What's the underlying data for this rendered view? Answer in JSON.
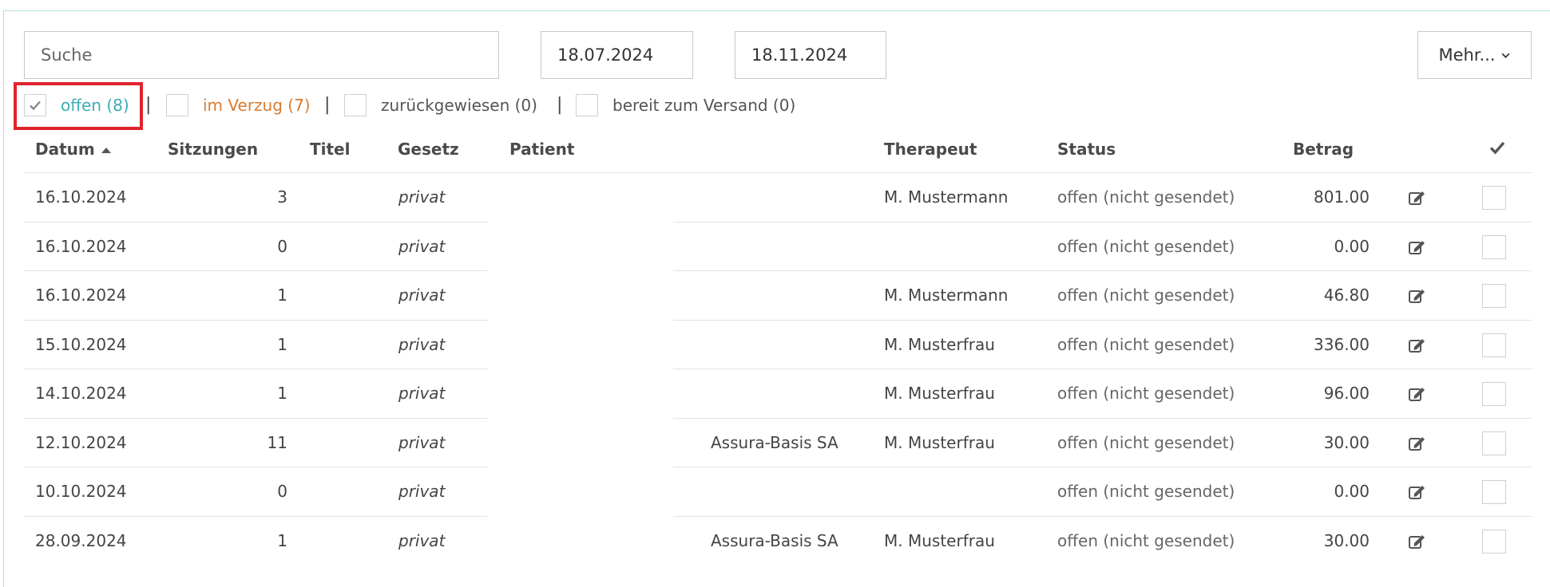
{
  "search": {
    "placeholder": "Suche"
  },
  "date_range": {
    "from": "18.07.2024",
    "to": "18.11.2024"
  },
  "more_button": {
    "label": "Mehr..."
  },
  "filters": [
    {
      "label": "offen (8)",
      "checked": true,
      "color": "#3aaeb5"
    },
    {
      "label": "im Verzug (7)",
      "checked": false,
      "color": "#d97b2e"
    },
    {
      "label": "zurückgewiesen (0)",
      "checked": false,
      "color": "#555555"
    },
    {
      "label": "bereit zum Versand (0)",
      "checked": false,
      "color": "#555555"
    }
  ],
  "separator": "|",
  "table": {
    "columns": {
      "date": "Datum",
      "sessions": "Sitzungen",
      "title": "Titel",
      "law": "Gesetz",
      "patient": "Patient",
      "therapist": "Therapeut",
      "status": "Status",
      "amount": "Betrag"
    },
    "sort": {
      "column": "date",
      "direction": "ascending"
    },
    "rows": [
      {
        "date": "16.10.2024",
        "sessions": "3",
        "law": "privat",
        "insurer": "",
        "therapist": "M. Mustermann",
        "status": "offen (nicht gesendet)",
        "amount": "801.00"
      },
      {
        "date": "16.10.2024",
        "sessions": "0",
        "law": "privat",
        "insurer": "",
        "therapist": "",
        "status": "offen (nicht gesendet)",
        "amount": "0.00"
      },
      {
        "date": "16.10.2024",
        "sessions": "1",
        "law": "privat",
        "insurer": "",
        "therapist": "M. Mustermann",
        "status": "offen (nicht gesendet)",
        "amount": "46.80"
      },
      {
        "date": "15.10.2024",
        "sessions": "1",
        "law": "privat",
        "insurer": "",
        "therapist": "M. Musterfrau",
        "status": "offen (nicht gesendet)",
        "amount": "336.00"
      },
      {
        "date": "14.10.2024",
        "sessions": "1",
        "law": "privat",
        "insurer": "",
        "therapist": "M. Musterfrau",
        "status": "offen (nicht gesendet)",
        "amount": "96.00"
      },
      {
        "date": "12.10.2024",
        "sessions": "11",
        "law": "privat",
        "insurer": "Assura-Basis SA",
        "therapist": "M. Musterfrau",
        "status": "offen (nicht gesendet)",
        "amount": "30.00"
      },
      {
        "date": "10.10.2024",
        "sessions": "0",
        "law": "privat",
        "insurer": "",
        "therapist": "",
        "status": "offen (nicht gesendet)",
        "amount": "0.00"
      },
      {
        "date": "28.09.2024",
        "sessions": "1",
        "law": "privat",
        "insurer": "Assura-Basis SA",
        "therapist": "M. Musterfrau",
        "status": "offen (nicht gesendet)",
        "amount": "30.00"
      }
    ]
  },
  "icons": {
    "sort": "sort-ascending-icon",
    "select_all": "checkmark-icon",
    "edit": "edit-icon",
    "dropdown": "chevron-down-icon"
  },
  "colors": {
    "accent": "#3aaeb5",
    "overdue": "#d97b2e",
    "highlight": "#e0232c",
    "frame": "#b6dedc"
  }
}
